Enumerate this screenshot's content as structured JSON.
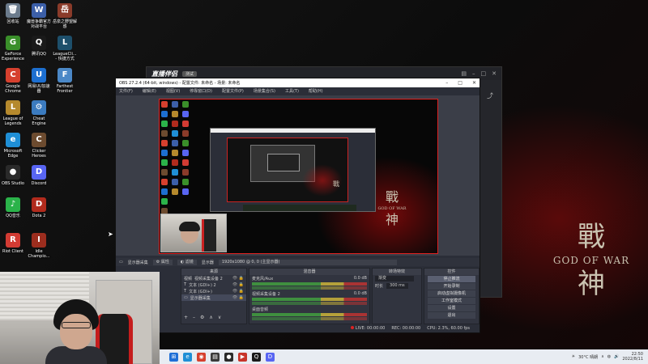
{
  "desktop": {
    "icons": [
      {
        "label": "回收站",
        "glyph": "🗑",
        "color": "#6b7b8c"
      },
      {
        "label": "魔兽争霸官方对战平台",
        "glyph": "W",
        "color": "#3c5fa8"
      },
      {
        "label": "岳泉之野望解惑",
        "glyph": "岳",
        "color": "#8a3b2a"
      },
      {
        "label": "GeForce Experience",
        "glyph": "G",
        "color": "#3a8f2a"
      },
      {
        "label": "腾讯QQ",
        "glyph": "Q",
        "color": "#1a1a1a"
      },
      {
        "label": "LeagueCli... - 快捷方式",
        "glyph": "L",
        "color": "#1d4f6b"
      },
      {
        "label": "Google Chrome",
        "glyph": "C",
        "color": "#d6402e"
      },
      {
        "label": "网易UU加速器",
        "glyph": "U",
        "color": "#1d6fd0"
      },
      {
        "label": "Farthest Frontier",
        "glyph": "F",
        "color": "#4b88c7"
      },
      {
        "label": "League of Legends",
        "glyph": "L",
        "color": "#b5892d"
      },
      {
        "label": "Cheat Engine",
        "glyph": "⚙",
        "color": "#3b7bbf"
      },
      {
        "label": "Microsoft Edge",
        "glyph": "e",
        "color": "#1f8fd6"
      },
      {
        "label": "Clicker Heroes",
        "glyph": "C",
        "color": "#6c4b2f"
      },
      {
        "label": "OBS Studio",
        "glyph": "●",
        "color": "#2a2a2a"
      },
      {
        "label": "Discord",
        "glyph": "D",
        "color": "#5865f2"
      },
      {
        "label": "QQ音乐",
        "glyph": "♪",
        "color": "#2bb34a"
      },
      {
        "label": "Dota 2",
        "glyph": "D",
        "color": "#b12b1d"
      },
      {
        "label": "Riot Client",
        "glyph": "R",
        "color": "#d23b33"
      },
      {
        "label": "Idle Champio...",
        "glyph": "I",
        "color": "#9c2d1e"
      }
    ]
  },
  "wallpaper": {
    "cjk_top": "戰",
    "english": "GOD OF WAR",
    "cjk_bottom": "神"
  },
  "back_window": {
    "app_name": "直播伴侣",
    "badge": "测试"
  },
  "obs": {
    "title": "OBS 27.2.4 (64-bit, windows) - 配置文件: 未命名 - 场景: 未命名",
    "menu": [
      "文件(F)",
      "编辑(E)",
      "视图(V)",
      "停靠窗口(D)",
      "配置文件(P)",
      "场景集合(S)",
      "工具(T)",
      "帮助(H)"
    ],
    "source_bar": {
      "selected": "显示器采集",
      "properties": "属性",
      "filters": "滤镜",
      "display_label": "显示器",
      "display_value": "1920x1080 @ 0, 0 (主显示器)"
    },
    "sources": {
      "header": "来源",
      "items": [
        {
          "type": "视频",
          "name": "视频采集设备 2"
        },
        {
          "type": "T",
          "name": "文本 (GDI+) 2"
        },
        {
          "type": "T",
          "name": "文本 (GDI+)"
        },
        {
          "type": "▭",
          "name": "显示器采集"
        }
      ]
    },
    "mixer": {
      "header": "混音器",
      "rows": [
        {
          "name": "麦克风/Aux",
          "level": "0.0 dB"
        },
        {
          "name": "视频采集设备 2",
          "level": "0.0 dB"
        },
        {
          "name": "桌面音频",
          "level": ""
        }
      ]
    },
    "transitions": {
      "header": "转场特效",
      "type": "渐变",
      "duration_label": "时长",
      "duration_value": "300 ms"
    },
    "controls": {
      "header": "控件",
      "buttons": [
        "停止推流",
        "开始录制",
        "启动虚拟摄像机",
        "工作室模式",
        "设置",
        "退出"
      ]
    },
    "status": {
      "live": "LIVE: 00:00:00",
      "rec": "REC: 00:00:00",
      "cpu": "CPU: 2.3%, 60.00 fps"
    }
  },
  "taskbar": {
    "weather": "30°C 晴朗",
    "time": "22:50",
    "date": "2022/8/11"
  },
  "colors": {
    "obs_bg": "#2b2e38",
    "preview_border": "#e02020",
    "accent_red": "#c51d1d"
  }
}
